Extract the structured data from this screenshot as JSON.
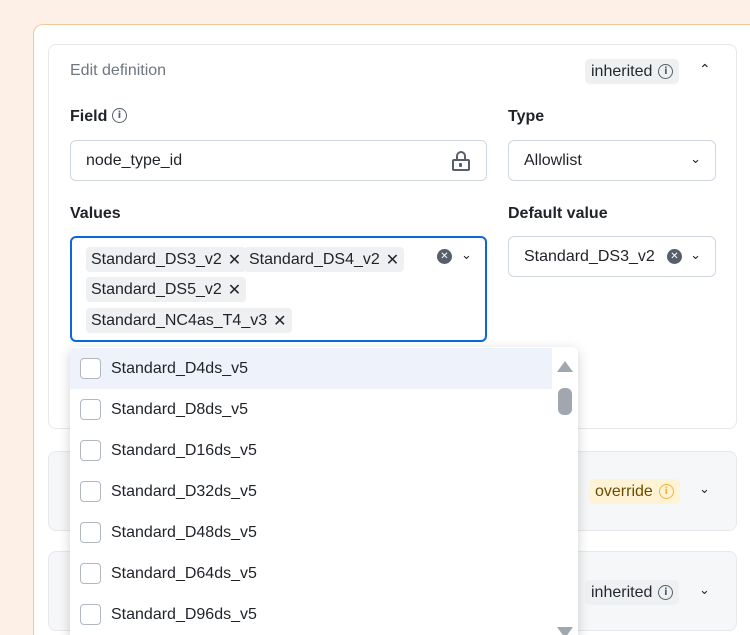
{
  "definition": {
    "title": "Edit definition",
    "badge": "inherited",
    "field_label": "Field",
    "field_value": "node_type_id",
    "type_label": "Type",
    "type_value": "Allowlist",
    "values_label": "Values",
    "selected_values": [
      "Standard_DS3_v2",
      "Standard_DS4_v2",
      "Standard_DS5_v2",
      "Standard_NC4as_T4_v3"
    ],
    "default_label": "Default value",
    "default_value": "Standard_DS3_v2"
  },
  "dropdown": {
    "options": [
      "Standard_D4ds_v5",
      "Standard_D8ds_v5",
      "Standard_D16ds_v5",
      "Standard_D32ds_v5",
      "Standard_D48ds_v5",
      "Standard_D64ds_v5",
      "Standard_D96ds_v5"
    ]
  },
  "collapsed_cards": [
    {
      "badge": "override"
    },
    {
      "badge": "inherited"
    }
  ],
  "icons": {
    "info": "info-icon",
    "lock": "lock-icon",
    "chevron": "chevron-icon",
    "clear": "clear-icon",
    "remove": "remove-chip-icon"
  },
  "colors": {
    "focus_border": "#0969da",
    "override_badge": "#fff3d6",
    "inherited_badge": "#eef0f2",
    "page_background": "#fdf1e7"
  }
}
